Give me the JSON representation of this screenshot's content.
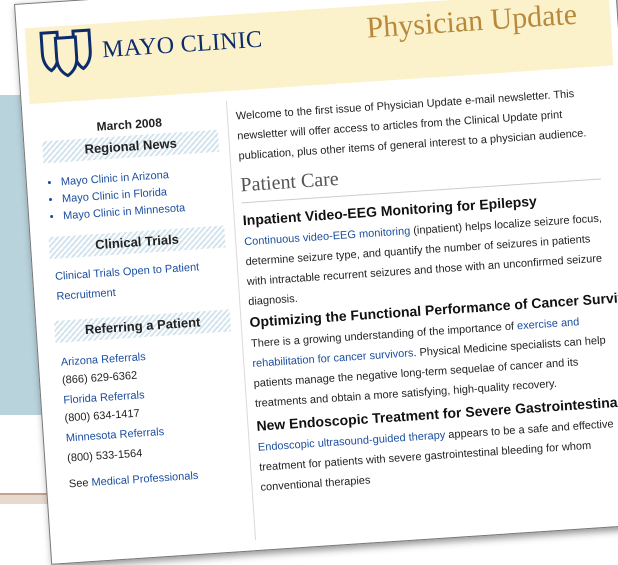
{
  "brand": {
    "logo_text": "MAYO CLINIC",
    "masthead": "Physician Update"
  },
  "sidebar": {
    "date": "March 2008",
    "regional_news": {
      "heading": "Regional News",
      "items": [
        "Mayo Clinic in Arizona",
        "Mayo Clinic in Florida",
        "Mayo Clinic in Minnesota"
      ]
    },
    "clinical_trials": {
      "heading": "Clinical Trials",
      "link_line1": "Clinical Trials Open to Patient",
      "link_line2": "Recruitment"
    },
    "referring": {
      "heading": "Referring a Patient",
      "entries": [
        {
          "label": "Arizona Referrals",
          "phone": "(866) 629-6362"
        },
        {
          "label": "Florida Referrals",
          "phone": "(800) 634-1417"
        },
        {
          "label": "Minnesota Referrals",
          "phone": "(800) 533-1564"
        }
      ],
      "see_prefix": "See",
      "see_link": "Medical Professionals"
    }
  },
  "main": {
    "intro": "Welcome to the first issue of Physician Update e-mail newsletter. This newsletter will offer access to articles from the Clinical Update print publication, plus other items of general interest to a physician audience.",
    "section_title": "Patient Care",
    "articles": [
      {
        "title": "Inpatient Video-EEG Monitoring for Epilepsy",
        "link": "Continuous video-EEG monitoring",
        "text": " (inpatient) helps localize seizure focus, determine seizure type, and quantify the number of seizures in patients with intractable recurrent seizures and those with an unconfirmed seizure diagnosis."
      },
      {
        "title": "Optimizing the Functional Performance of Cancer Survivors",
        "lead": "There is a growing understanding of the importance of ",
        "link": "exercise and rehabilitation for cancer survivors",
        "text": ". Physical Medicine specialists can help patients manage the negative long-term sequelae of cancer and its treatments and obtain a more satisfying, high-quality recovery."
      },
      {
        "title": "New Endoscopic Treatment for Severe Gastrointestinal Bleeding",
        "link": "Endoscopic ultrasound-guided therapy",
        "text": " appears to be a safe and effective treatment for patients with severe gastrointestinal bleeding for whom conventional therapies"
      }
    ]
  },
  "colors": {
    "background_band": "#b9d3dd",
    "header_band": "#fbf2cc",
    "brand_blue": "#0c2c6b",
    "masthead_gold": "#b8893a",
    "link_blue": "#1c4fa0"
  },
  "icons": {
    "logo": "mayo-three-shields-logo"
  }
}
